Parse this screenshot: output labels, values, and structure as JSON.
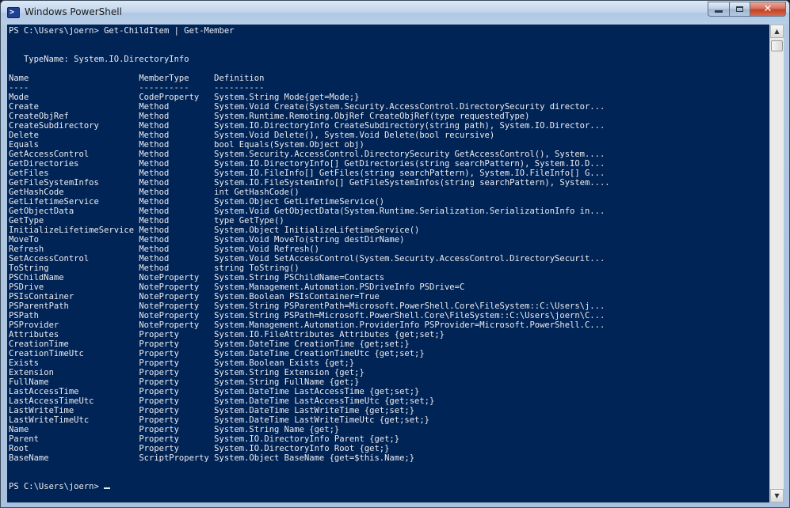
{
  "window": {
    "title": "Windows PowerShell",
    "icon": "powershell-icon",
    "close_glyph": "✕"
  },
  "colors": {
    "console_background": "#012456",
    "console_foreground": "#eeedf0"
  },
  "console": {
    "lines": [
      "PS C:\\Users\\joern> Get-ChildItem | Get-Member",
      "",
      "",
      "   TypeName: System.IO.DirectoryInfo",
      "",
      "Name                      MemberType     Definition",
      "----                      ----------     ----------",
      "Mode                      CodeProperty   System.String Mode{get=Mode;}",
      "Create                    Method         System.Void Create(System.Security.AccessControl.DirectorySecurity director...",
      "CreateObjRef              Method         System.Runtime.Remoting.ObjRef CreateObjRef(type requestedType)",
      "CreateSubdirectory        Method         System.IO.DirectoryInfo CreateSubdirectory(string path), System.IO.Director...",
      "Delete                    Method         System.Void Delete(), System.Void Delete(bool recursive)",
      "Equals                    Method         bool Equals(System.Object obj)",
      "GetAccessControl          Method         System.Security.AccessControl.DirectorySecurity GetAccessControl(), System....",
      "GetDirectories            Method         System.IO.DirectoryInfo[] GetDirectories(string searchPattern), System.IO.D...",
      "GetFiles                  Method         System.IO.FileInfo[] GetFiles(string searchPattern), System.IO.FileInfo[] G...",
      "GetFileSystemInfos        Method         System.IO.FileSystemInfo[] GetFileSystemInfos(string searchPattern), System....",
      "GetHashCode               Method         int GetHashCode()",
      "GetLifetimeService        Method         System.Object GetLifetimeService()",
      "GetObjectData             Method         System.Void GetObjectData(System.Runtime.Serialization.SerializationInfo in...",
      "GetType                   Method         type GetType()",
      "InitializeLifetimeService Method         System.Object InitializeLifetimeService()",
      "MoveTo                    Method         System.Void MoveTo(string destDirName)",
      "Refresh                   Method         System.Void Refresh()",
      "SetAccessControl          Method         System.Void SetAccessControl(System.Security.AccessControl.DirectorySecurit...",
      "ToString                  Method         string ToString()",
      "PSChildName               NoteProperty   System.String PSChildName=Contacts",
      "PSDrive                   NoteProperty   System.Management.Automation.PSDriveInfo PSDrive=C",
      "PSIsContainer             NoteProperty   System.Boolean PSIsContainer=True",
      "PSParentPath              NoteProperty   System.String PSParentPath=Microsoft.PowerShell.Core\\FileSystem::C:\\Users\\j...",
      "PSPath                    NoteProperty   System.String PSPath=Microsoft.PowerShell.Core\\FileSystem::C:\\Users\\joern\\C...",
      "PSProvider                NoteProperty   System.Management.Automation.ProviderInfo PSProvider=Microsoft.PowerShell.C...",
      "Attributes                Property       System.IO.FileAttributes Attributes {get;set;}",
      "CreationTime              Property       System.DateTime CreationTime {get;set;}",
      "CreationTimeUtc           Property       System.DateTime CreationTimeUtc {get;set;}",
      "Exists                    Property       System.Boolean Exists {get;}",
      "Extension                 Property       System.String Extension {get;}",
      "FullName                  Property       System.String FullName {get;}",
      "LastAccessTime            Property       System.DateTime LastAccessTime {get;set;}",
      "LastAccessTimeUtc         Property       System.DateTime LastAccessTimeUtc {get;set;}",
      "LastWriteTime             Property       System.DateTime LastWriteTime {get;set;}",
      "LastWriteTimeUtc          Property       System.DateTime LastWriteTimeUtc {get;set;}",
      "Name                      Property       System.String Name {get;}",
      "Parent                    Property       System.IO.DirectoryInfo Parent {get;}",
      "Root                      Property       System.IO.DirectoryInfo Root {get;}",
      "BaseName                  ScriptProperty System.Object BaseName {get=$this.Name;}",
      "",
      "",
      "PS C:\\Users\\joern> "
    ]
  }
}
